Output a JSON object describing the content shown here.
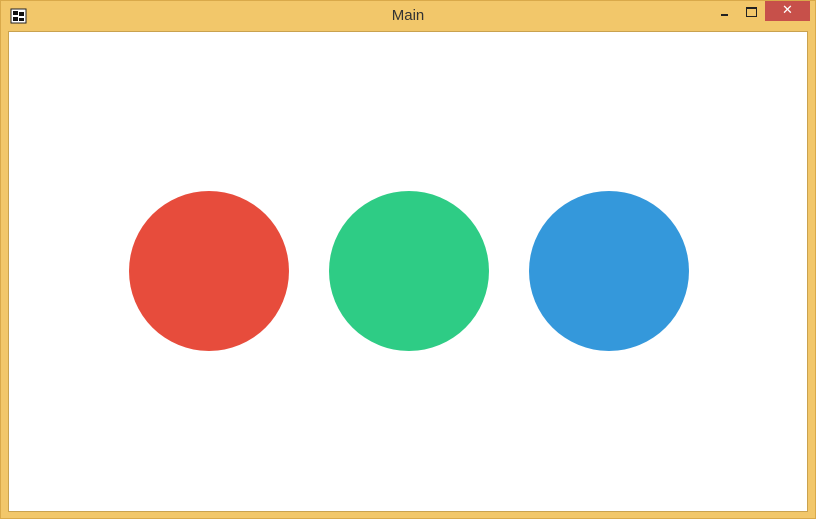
{
  "window": {
    "title": "Main",
    "app_icon": "app-logo-icon",
    "controls": {
      "minimize_icon": "minimize-icon",
      "maximize_icon": "maximize-icon",
      "close_label": "✕",
      "close_icon": "close-icon"
    },
    "colors": {
      "frame": "#f2c76a",
      "close_button": "#c7504a"
    }
  },
  "content": {
    "circles": [
      {
        "name": "red",
        "color": "#e74c3c"
      },
      {
        "name": "green",
        "color": "#2ecc85"
      },
      {
        "name": "blue",
        "color": "#3498db"
      }
    ]
  }
}
